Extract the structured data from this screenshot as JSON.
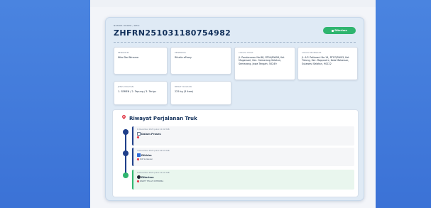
{
  "order": {
    "label": "NOMOR ORDER / RESI",
    "id": "ZHFRN251031180754982",
    "status": "Diterima"
  },
  "info": [
    {
      "label": "PENGIRIM",
      "value": "Niko Dwi Ninama"
    },
    {
      "label": "PENERIMA",
      "value": "Rihalia eProxy"
    },
    {
      "label": "LOKASI MUAT",
      "value": "Jl. Pandanaran No.88, RT04/RW08, Kel. Mugassari, Kec. Semarang Selatan, Semarang, Jawa Tengah, 50249"
    },
    {
      "label": "LOKASI BONGKAR",
      "value": "Jl. A.P. Pettarani No.14, RT07/RW03, Kel. Tidung, Kec. Rappocini, Kota Makassar, Sulawesi Selatan, 90222"
    },
    {
      "label": "JENIS MUATAN",
      "value": "1. SEMEN / 2. Tepung / 3. Terigu"
    },
    {
      "label": "BERAT MUATAN",
      "value": "225 kg (3 Item)"
    }
  ],
  "timeline": {
    "title": "Riwayat Perjalanan Truk",
    "entries": [
      {
        "date": "1 November 2025 pukul 11.52 WIB",
        "status": "Dalam Proses",
        "location": ""
      },
      {
        "date": "3 November 2025 pukul 09.53 WIB",
        "status": "Dikirim",
        "location": "Kot Sulawesi"
      },
      {
        "date": "5 November 2025 pukul 10.11 WIB",
        "status": "Diterima",
        "location": "PAKET TELAH DITERIMA"
      }
    ]
  },
  "colors": {
    "accent": "#2fb56f",
    "primary": "#12305a",
    "timeline": "#1f3f8a",
    "pin": "#e23b4a",
    "side_band": "#3b72d6"
  }
}
